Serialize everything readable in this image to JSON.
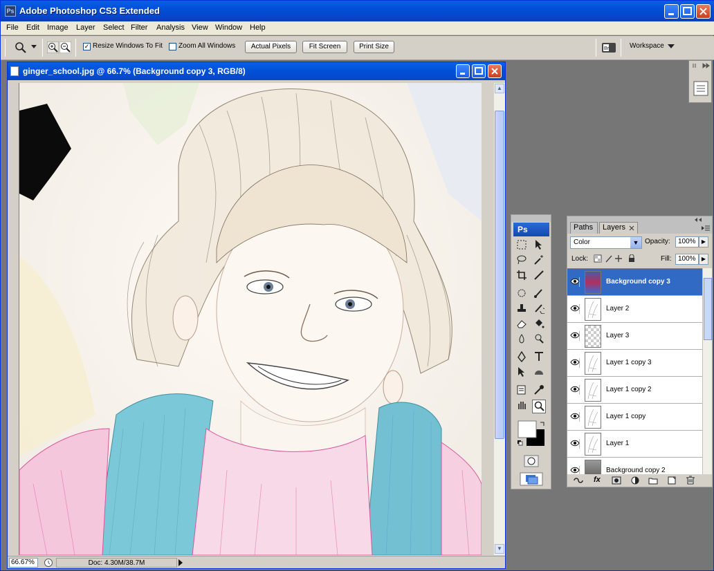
{
  "app": {
    "title": "Adobe Photoshop CS3 Extended",
    "logo": "Ps"
  },
  "menu": [
    "File",
    "Edit",
    "Image",
    "Layer",
    "Select",
    "Filter",
    "Analysis",
    "View",
    "Window",
    "Help"
  ],
  "options": {
    "resize_label": "Resize Windows To Fit",
    "resize_checked": true,
    "zoomall_label": "Zoom All Windows",
    "zoomall_checked": false,
    "actual_pixels": "Actual Pixels",
    "fit_screen": "Fit Screen",
    "print_size": "Print Size",
    "workspace": "Workspace"
  },
  "document": {
    "title": "ginger_school.jpg @ 66.7% (Background copy 3, RGB/8)",
    "zoom": "66.67%",
    "doc_size": "Doc: 4.30M/38.7M"
  },
  "toolbox": {
    "logo": "Ps"
  },
  "layers_panel": {
    "tabs": [
      "Paths",
      "Layers"
    ],
    "active_tab": "Layers",
    "blend_mode": "Color",
    "opacity_label": "Opacity:",
    "opacity": "100%",
    "lock_label": "Lock:",
    "fill_label": "Fill:",
    "fill": "100%",
    "layers": [
      {
        "name": "Background copy 3",
        "selected": true,
        "thumb": "photo"
      },
      {
        "name": "Layer 2",
        "selected": false,
        "thumb": "sketch"
      },
      {
        "name": "Layer 3",
        "selected": false,
        "thumb": "checker"
      },
      {
        "name": "Layer 1 copy 3",
        "selected": false,
        "thumb": "sketch"
      },
      {
        "name": "Layer 1 copy 2",
        "selected": false,
        "thumb": "sketch"
      },
      {
        "name": "Layer 1 copy",
        "selected": false,
        "thumb": "sketch"
      },
      {
        "name": "Layer 1",
        "selected": false,
        "thumb": "sketch"
      },
      {
        "name": "Background copy 2",
        "selected": false,
        "thumb": "gray"
      }
    ]
  },
  "colors": {
    "accent": "#316ac5",
    "titlebar": "#0050d6"
  }
}
